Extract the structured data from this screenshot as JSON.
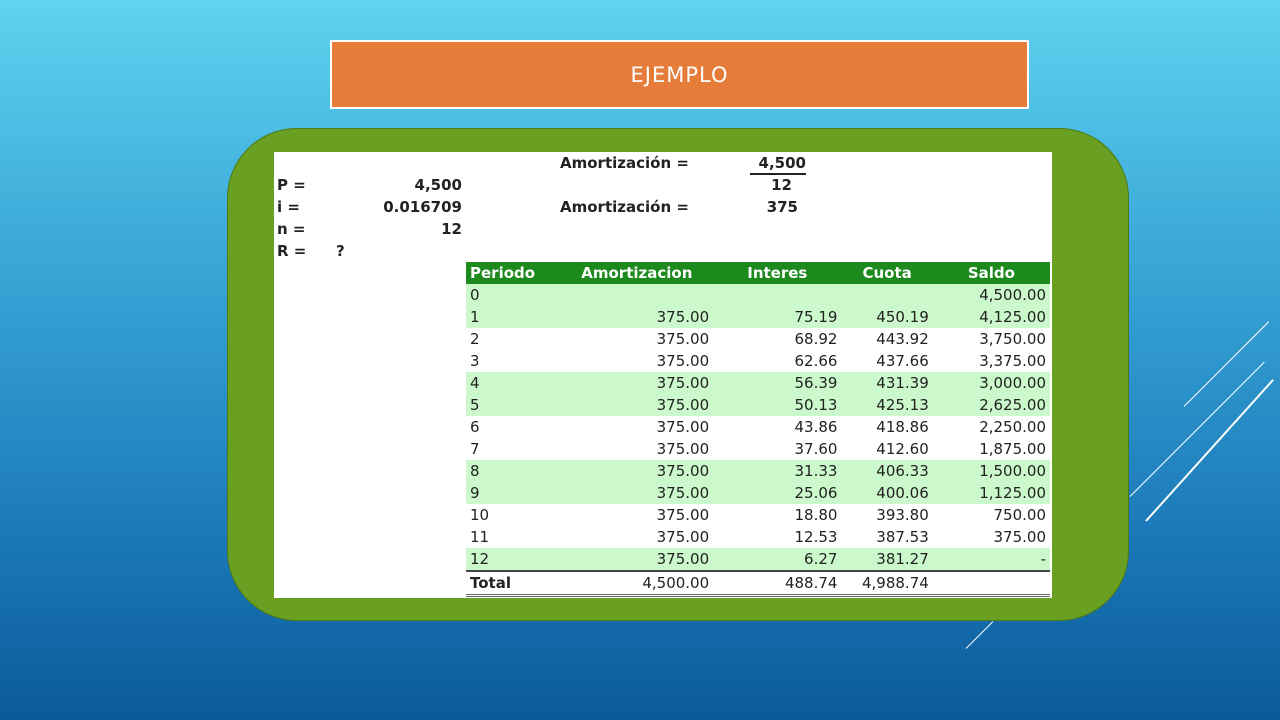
{
  "title": "EJEMPLO",
  "formula": {
    "amort_label_1": "Amortización =",
    "numerator": "4,500",
    "denominator": "12",
    "amort_label_2": "Amortización =",
    "result": "375"
  },
  "inputs": [
    {
      "label": "P =",
      "value": "4,500"
    },
    {
      "label": "i =",
      "value": "0.016709"
    },
    {
      "label": "n =",
      "value": "12"
    },
    {
      "label": "R =",
      "value": "?"
    }
  ],
  "table": {
    "headers": [
      "Periodo",
      "Amortizacion",
      "Interes",
      "Cuota",
      "Saldo"
    ],
    "rows": [
      [
        "0",
        "",
        "",
        "",
        "4,500.00"
      ],
      [
        "1",
        "375.00",
        "75.19",
        "450.19",
        "4,125.00"
      ],
      [
        "2",
        "375.00",
        "68.92",
        "443.92",
        "3,750.00"
      ],
      [
        "3",
        "375.00",
        "62.66",
        "437.66",
        "3,375.00"
      ],
      [
        "4",
        "375.00",
        "56.39",
        "431.39",
        "3,000.00"
      ],
      [
        "5",
        "375.00",
        "50.13",
        "425.13",
        "2,625.00"
      ],
      [
        "6",
        "375.00",
        "43.86",
        "418.86",
        "2,250.00"
      ],
      [
        "7",
        "375.00",
        "37.60",
        "412.60",
        "1,875.00"
      ],
      [
        "8",
        "375.00",
        "31.33",
        "406.33",
        "1,500.00"
      ],
      [
        "9",
        "375.00",
        "25.06",
        "400.06",
        "1,125.00"
      ],
      [
        "10",
        "375.00",
        "18.80",
        "393.80",
        "750.00"
      ],
      [
        "11",
        "375.00",
        "12.53",
        "387.53",
        "375.00"
      ],
      [
        "12",
        "375.00",
        "6.27",
        "381.27",
        "-"
      ]
    ],
    "total": [
      "Total",
      "4,500.00",
      "488.74",
      "4,988.74",
      ""
    ]
  },
  "colors": {
    "header_green": "#1d8a1d",
    "row_shade": "#ccf9cc",
    "title_orange": "#e57c39",
    "panel_green": "#6aa021"
  }
}
